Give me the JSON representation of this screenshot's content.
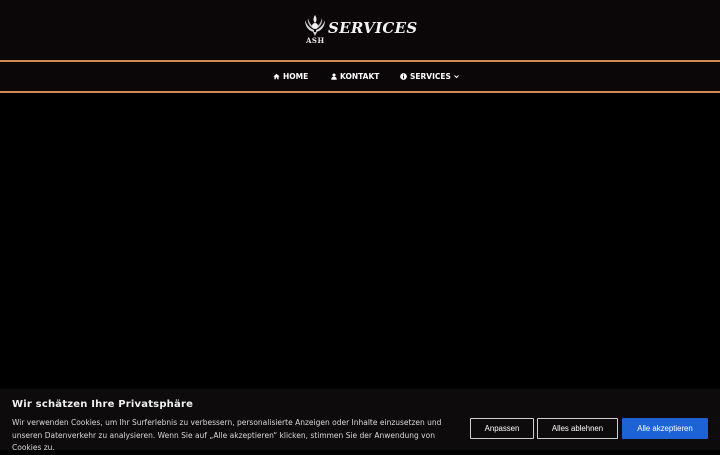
{
  "header": {
    "logo": {
      "emblem_icon": "eagle-emblem-icon",
      "small_text": "ASH",
      "title": "SERVICES"
    }
  },
  "nav": {
    "items": [
      {
        "label": "HOME",
        "icon": "home-icon"
      },
      {
        "label": "KONTAKT",
        "icon": "user-icon"
      },
      {
        "label": "SERVICES",
        "icon": "info-circle-icon",
        "dropdown_icon": "chevron-down-icon"
      }
    ]
  },
  "cookie_banner": {
    "title": "Wir schätzen Ihre Privatsphäre",
    "text": "Wir verwenden Cookies, um Ihr Surferlebnis zu verbessern, personalisierte Anzeigen oder Inhalte einzusetzen und unseren Datenverkehr zu analysieren. Wenn Sie auf „Alle akzeptieren“ klicken, stimmen Sie der Anwendung von Cookies zu.",
    "buttons": {
      "customize": "Anpassen",
      "reject": "Alles ablehnen",
      "accept": "Alle akzeptieren"
    }
  },
  "colors": {
    "accent_border": "#d38a56",
    "accept_button": "#1e63d6",
    "page_background": "#000000",
    "header_background": "#0b0708"
  }
}
